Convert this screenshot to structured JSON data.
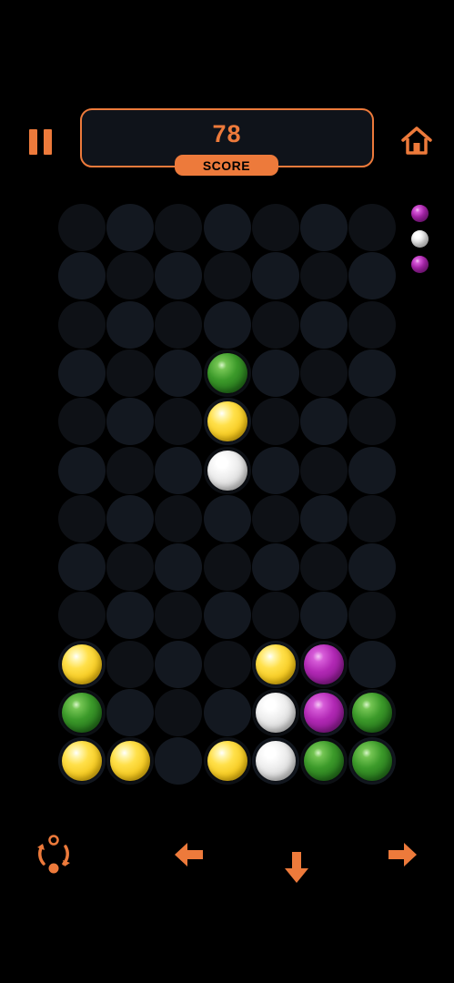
{
  "header": {
    "pause_icon": "pause-icon",
    "home_icon": "home-icon",
    "score_value": "78",
    "score_label": "SCORE"
  },
  "colors": {
    "accent": "#ed7a3b",
    "background": "#000000",
    "cell_dark": "#0e1116",
    "cell_light": "#131820",
    "yellow": "#f3c518",
    "green": "#3c9a2a",
    "white": "#eeeeee",
    "purple": "#b128b4"
  },
  "next_queue": [
    "purple",
    "white",
    "purple"
  ],
  "board": {
    "columns": 7,
    "rows": 12,
    "grid": [
      [
        null,
        null,
        null,
        null,
        null,
        null,
        null
      ],
      [
        null,
        null,
        null,
        null,
        null,
        null,
        null
      ],
      [
        null,
        null,
        null,
        null,
        null,
        null,
        null
      ],
      [
        null,
        null,
        null,
        "green",
        null,
        null,
        null
      ],
      [
        null,
        null,
        null,
        "yellow",
        null,
        null,
        null
      ],
      [
        null,
        null,
        null,
        "white",
        null,
        null,
        null
      ],
      [
        null,
        null,
        null,
        null,
        null,
        null,
        null
      ],
      [
        null,
        null,
        null,
        null,
        null,
        null,
        null
      ],
      [
        null,
        null,
        null,
        null,
        null,
        null,
        null
      ],
      [
        "yellow",
        null,
        null,
        null,
        "yellow",
        "purple",
        null
      ],
      [
        "green",
        null,
        null,
        null,
        "white",
        "purple",
        "green"
      ],
      [
        "yellow",
        "yellow",
        null,
        "yellow",
        "white",
        "green",
        "green"
      ]
    ]
  },
  "controls": {
    "rotate_icon": "rotate-icon",
    "left_icon": "arrow-left-icon",
    "down_icon": "arrow-down-icon",
    "right_icon": "arrow-right-icon"
  }
}
